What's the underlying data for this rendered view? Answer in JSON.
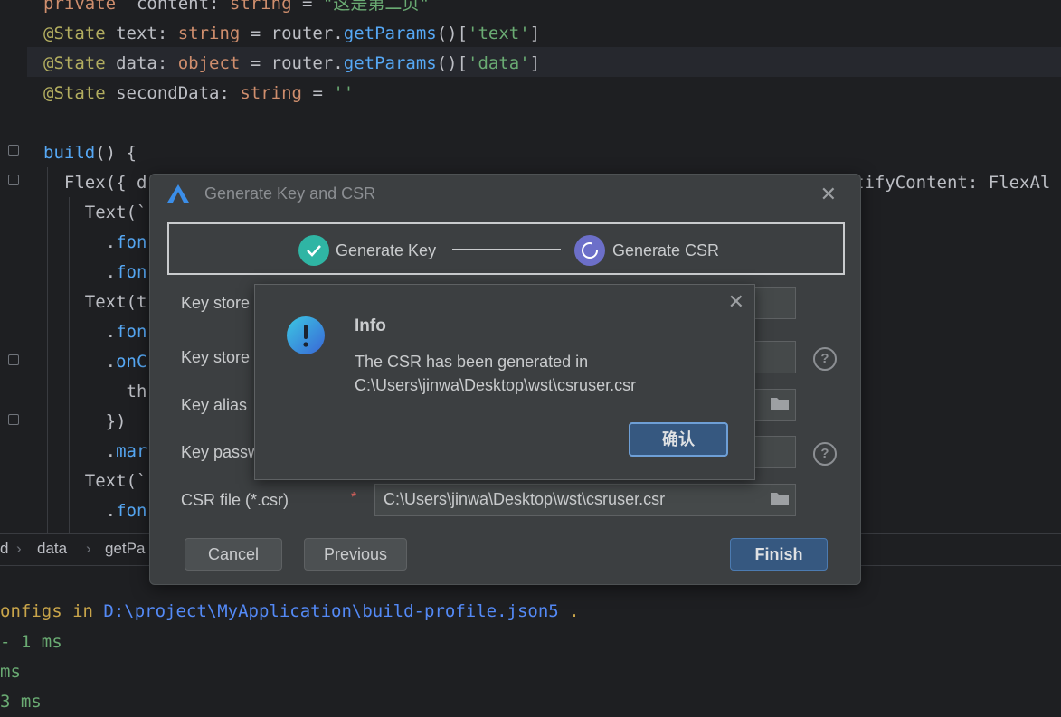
{
  "editor": {
    "lines": [
      {
        "segments": [
          [
            "kw",
            "private"
          ],
          [
            "",
            "  content: "
          ],
          [
            "typ",
            "string"
          ],
          [
            "",
            " = "
          ],
          [
            "str",
            "\"这是第二页\""
          ]
        ]
      },
      {
        "segments": [
          [
            "ann",
            "@State"
          ],
          [
            "",
            " text: "
          ],
          [
            "typ",
            "string"
          ],
          [
            "",
            " = router."
          ],
          [
            "fn",
            "getParams"
          ],
          [
            "",
            "()["
          ],
          [
            "str",
            "'text'"
          ],
          [
            "",
            "]"
          ]
        ]
      },
      {
        "segments": [
          [
            "ann",
            "@State"
          ],
          [
            "",
            " data: "
          ],
          [
            "typ",
            "object"
          ],
          [
            "",
            " = router."
          ],
          [
            "fn",
            "getParams"
          ],
          [
            "",
            "()["
          ],
          [
            "str",
            "'data'"
          ],
          [
            "",
            "]"
          ]
        ]
      },
      {
        "segments": [
          [
            "ann",
            "@State"
          ],
          [
            "",
            " secondData: "
          ],
          [
            "typ",
            "string"
          ],
          [
            "",
            " = "
          ],
          [
            "str",
            "''"
          ]
        ]
      },
      {
        "segments": []
      },
      {
        "segments": [
          [
            "fn",
            "build"
          ],
          [
            "",
            "() {"
          ]
        ]
      },
      {
        "segments": [
          [
            "",
            "  Flex({ d"
          ],
          [
            "",
            " "
          ]
        ],
        "tail": "tifyContent: FlexAl"
      },
      {
        "segments": [
          [
            "",
            "    Text(`"
          ]
        ]
      },
      {
        "segments": [
          [
            "",
            "      ."
          ],
          [
            "fn",
            "fon"
          ]
        ]
      },
      {
        "segments": [
          [
            "",
            "      ."
          ],
          [
            "fn",
            "fon"
          ]
        ]
      },
      {
        "segments": [
          [
            "",
            "    Text(t"
          ]
        ]
      },
      {
        "segments": [
          [
            "",
            "      ."
          ],
          [
            "fn",
            "fon"
          ]
        ]
      },
      {
        "segments": [
          [
            "",
            "      ."
          ],
          [
            "fn",
            "onC"
          ]
        ]
      },
      {
        "segments": [
          [
            "",
            "        th"
          ]
        ]
      },
      {
        "segments": [
          [
            "",
            "      })"
          ]
        ]
      },
      {
        "segments": [
          [
            "",
            "      ."
          ],
          [
            "fn",
            "mar"
          ]
        ]
      },
      {
        "segments": [
          [
            "",
            "    Text(`"
          ]
        ]
      },
      {
        "segments": [
          [
            "",
            "      ."
          ],
          [
            "fn",
            "fon"
          ]
        ]
      }
    ]
  },
  "breadcrumb": {
    "items": [
      "d",
      "data",
      "getPa"
    ]
  },
  "console": {
    "line1_prefix": "onfigs in ",
    "line1_link": "D:\\project\\MyApplication\\build-profile.json5",
    "line1_suffix": " .",
    "line2": "- 1 ms",
    "line3": "ms",
    "line4": "3 ms"
  },
  "dialog": {
    "title": "Generate Key and CSR",
    "step1": "Generate Key",
    "step2": "Generate CSR",
    "labels": {
      "key_store": "Key store",
      "key_store_pwd": "Key store",
      "key_alias": "Key alias",
      "key_pwd": "Key passw",
      "csr_file": "CSR file (*.csr)"
    },
    "required_mark": "*",
    "csr_value": "C:\\Users\\jinwa\\Desktop\\wst\\csruser.csr",
    "help_glyph": "?",
    "buttons": {
      "cancel": "Cancel",
      "previous": "Previous",
      "finish": "Finish"
    }
  },
  "info": {
    "title": "Info",
    "message_line1": "The CSR has been generated in",
    "message_line2": "C:\\Users\\jinwa\\Desktop\\wst\\csruser.csr",
    "ok": "确认"
  },
  "colors": {
    "accent": "#365880",
    "step_done": "#2fb5a4",
    "step_active": "#6c6fc9"
  }
}
